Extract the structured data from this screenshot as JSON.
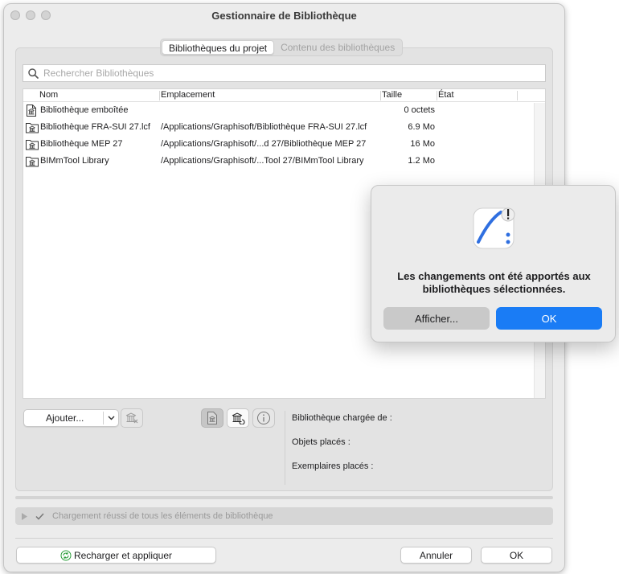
{
  "window": {
    "title": "Gestionnaire de Bibliothèque"
  },
  "tabs": [
    {
      "label": "Bibliothèques du projet",
      "active": true
    },
    {
      "label": "Contenu des bibliothèques",
      "active": false
    }
  ],
  "search": {
    "placeholder": "Rechercher Bibliothèques",
    "value": ""
  },
  "table": {
    "columns": [
      "Nom",
      "Emplacement",
      "Taille",
      "État"
    ],
    "rows": [
      {
        "icon": "library-file-icon",
        "name": "Bibliothèque emboîtée",
        "location": "",
        "size": "0 octets",
        "state": ""
      },
      {
        "icon": "library-folder-icon",
        "name": "Bibliothèque FRA-SUI 27.lcf",
        "location": "/Applications/Graphisoft/Bibliothèque FRA-SUI 27.lcf",
        "size": "6.9 Mo",
        "state": ""
      },
      {
        "icon": "library-folder-icon",
        "name": "Bibliothèque MEP 27",
        "location": "/Applications/Graphisoft/...d 27/Bibliothèque MEP 27",
        "size": "16 Mo",
        "state": ""
      },
      {
        "icon": "library-folder-icon",
        "name": "BIMmTool Library",
        "location": "/Applications/Graphisoft/...Tool 27/BIMmTool Library",
        "size": "1.2 Mo",
        "state": ""
      }
    ]
  },
  "toolbar": {
    "add_label": "Ajouter..."
  },
  "details": {
    "loaded_from": "Bibliothèque chargée de :",
    "placed_objects": "Objets placés :",
    "placed_instances": "Exemplaires placés :"
  },
  "status": {
    "text": "Chargement réussi de tous les éléments de bibliothèque"
  },
  "footer": {
    "reload_label": "Recharger et appliquer",
    "cancel_label": "Annuler",
    "ok_label": "OK"
  },
  "alert": {
    "message": "Les changements ont été apportés aux bibliothèques sélectionnées.",
    "show_label": "Afficher...",
    "ok_label": "OK"
  },
  "colors": {
    "accent": "#1a7cf5",
    "window_bg": "#ececec",
    "panel_bg": "#e3e3e3",
    "status_text": "#9a9a9a"
  }
}
